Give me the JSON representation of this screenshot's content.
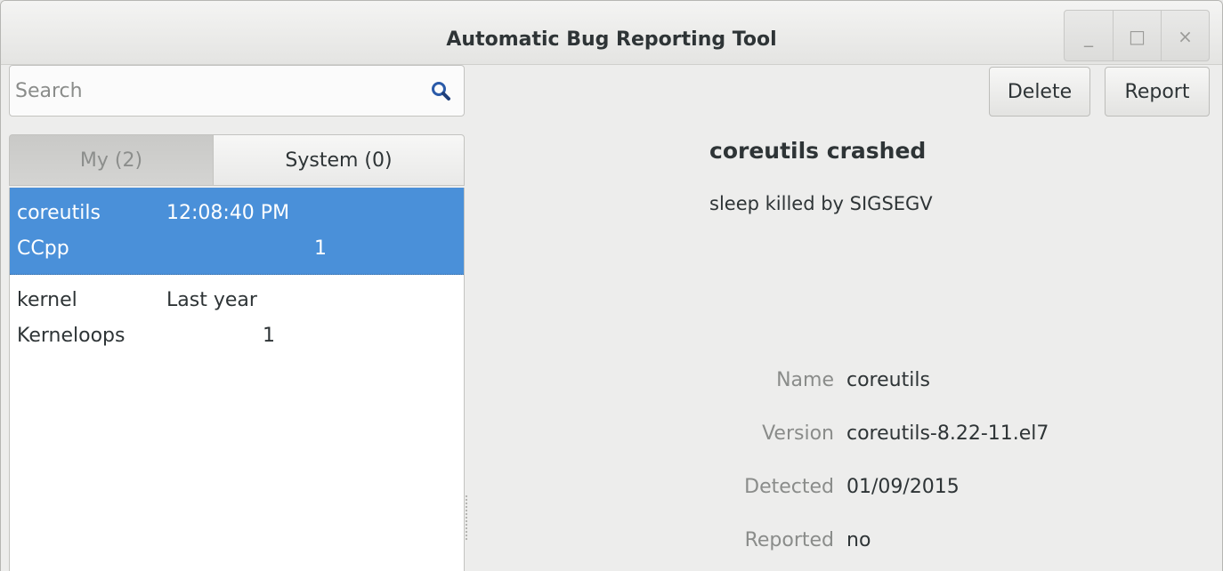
{
  "window": {
    "title": "Automatic Bug Reporting Tool",
    "controls": {
      "minimize": "_",
      "maximize": "□",
      "close": "×"
    }
  },
  "search": {
    "placeholder": "Search",
    "value": ""
  },
  "tabs": [
    {
      "label": "My (2)",
      "active": true
    },
    {
      "label": "System (0)",
      "active": false
    }
  ],
  "problems": [
    {
      "name": "coreutils",
      "time": "12:08:40 PM",
      "type": "CCpp",
      "count": "1",
      "selected": true
    },
    {
      "name": "kernel",
      "time": "Last year",
      "type": "Kerneloops",
      "count": "1",
      "selected": false
    }
  ],
  "toolbar": {
    "delete_label": "Delete",
    "report_label": "Report"
  },
  "detail": {
    "title": "coreutils crashed",
    "reason": "sleep killed by SIGSEGV",
    "properties": [
      {
        "key": "Name",
        "value": "coreutils"
      },
      {
        "key": "Version",
        "value": "coreutils-8.22-11.el7"
      },
      {
        "key": "Detected",
        "value": "01/09/2015"
      },
      {
        "key": "Reported",
        "value": "no"
      }
    ]
  },
  "colors": {
    "selection": "#4a90d9",
    "search_icon": "#2a5aa8"
  }
}
